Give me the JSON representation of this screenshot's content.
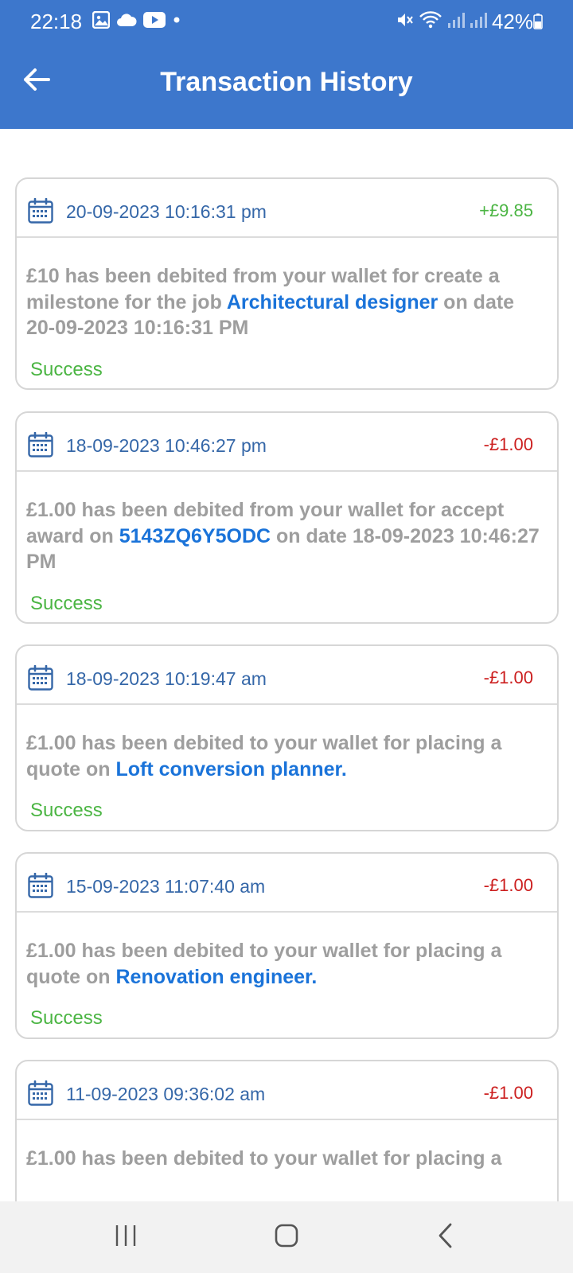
{
  "status_bar": {
    "time": "22:18",
    "battery": "42%",
    "left_icons": [
      "image-icon",
      "cloud-icon",
      "youtube-icon",
      "dot-icon"
    ],
    "right_icons": [
      "mute-icon",
      "wifi-icon",
      "signal-icon",
      "signal-icon",
      "battery-icon"
    ]
  },
  "header": {
    "title": "Transaction History",
    "back_icon": "arrow-left-icon"
  },
  "colors": {
    "header_bg": "#3d77cc",
    "date_text": "#3567a8",
    "credit": "#4bb543",
    "debit": "#cc1f1f",
    "link": "#1a73d9",
    "body_text": "#9e9e9e",
    "success": "#4bb543"
  },
  "transactions": [
    {
      "date": "20-09-2023 10:16:31 pm",
      "amount": "+£9.85",
      "type": "credit",
      "desc_before": "£10 has been debited from your wallet for create a milestone for the job ",
      "link": "Architectural designer",
      "desc_after": " on date 20-09-2023 10:16:31 PM",
      "status": "Success"
    },
    {
      "date": "18-09-2023 10:46:27 pm",
      "amount": "-£1.00",
      "type": "debit",
      "desc_before": "£1.00 has been debited from your wallet for accept award on ",
      "link": "5143ZQ6Y5ODC",
      "desc_after": " on date 18-09-2023 10:46:27 PM",
      "status": "Success"
    },
    {
      "date": "18-09-2023 10:19:47 am",
      "amount": "-£1.00",
      "type": "debit",
      "desc_before": "£1.00 has been debited to your wallet for placing a quote on ",
      "link": "Loft conversion planner.",
      "desc_after": "",
      "status": "Success"
    },
    {
      "date": "15-09-2023 11:07:40 am",
      "amount": "-£1.00",
      "type": "debit",
      "desc_before": "£1.00 has been debited to your wallet for placing a quote on ",
      "link": "Renovation engineer.",
      "desc_after": "",
      "status": "Success"
    },
    {
      "date": "11-09-2023 09:36:02 am",
      "amount": "-£1.00",
      "type": "debit",
      "desc_before": "£1.00 has been debited to your wallet for placing a",
      "link": "",
      "desc_after": "",
      "status": ""
    }
  ],
  "nav_bar": {
    "icons": [
      "recent-apps-icon",
      "home-icon",
      "back-icon"
    ]
  }
}
